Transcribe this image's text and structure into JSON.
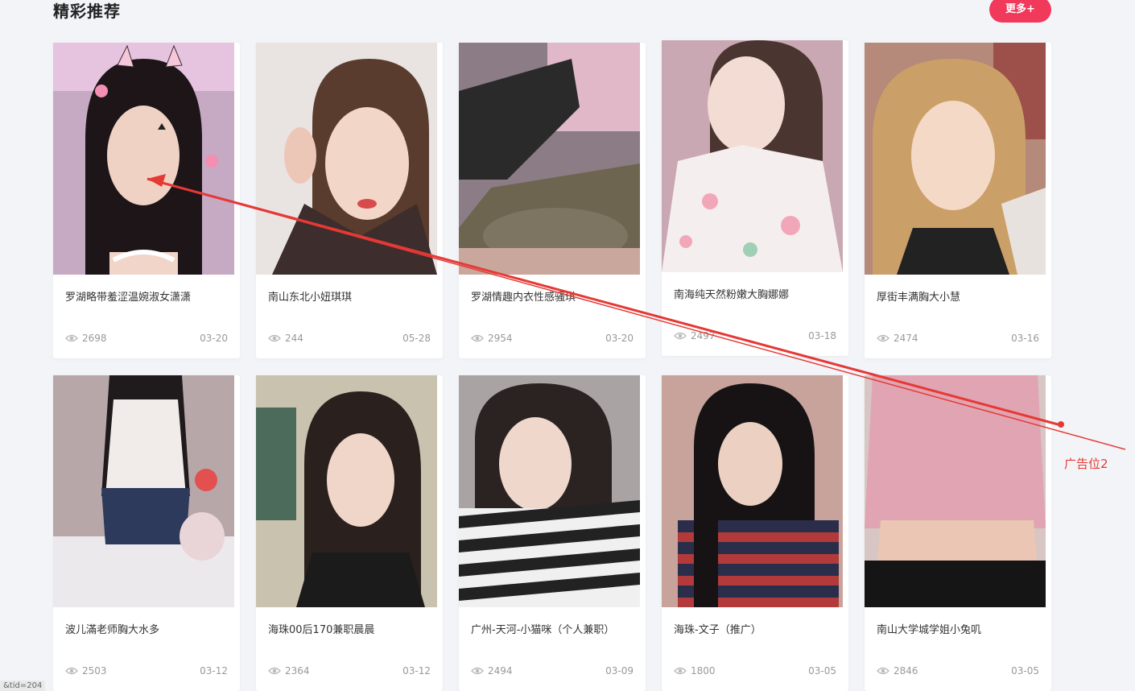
{
  "section": {
    "title": "精彩推荐",
    "more_label": "更多+"
  },
  "cards": [
    {
      "title": "罗湖略带羞涩温婉淑女潇潇",
      "views": "2698",
      "date": "03-20",
      "photo": "photo-woman-cat-ears"
    },
    {
      "title": "南山东北小妞琪琪",
      "views": "244",
      "date": "05-28",
      "photo": "photo-woman-selfie"
    },
    {
      "title": "罗湖情趣内衣性感骚琪",
      "views": "2954",
      "date": "03-20",
      "photo": "photo-fishnet-legs"
    },
    {
      "title": "南海纯天然粉嫩大胸娜娜",
      "views": "2497",
      "date": "03-18",
      "photo": "photo-woman-floral-shirt"
    },
    {
      "title": "厚街丰满胸大小慧",
      "views": "2474",
      "date": "03-16",
      "photo": "photo-woman-curly-hair"
    },
    {
      "title": "波儿滿老师胸大水多",
      "views": "2503",
      "date": "03-12",
      "photo": "photo-woman-white-top"
    },
    {
      "title": "海珠00后170兼职晨晨",
      "views": "2364",
      "date": "03-12",
      "photo": "photo-woman-long-hair"
    },
    {
      "title": "广州-天河-小猫咪（个人兼职）",
      "views": "2494",
      "date": "03-09",
      "photo": "photo-woman-striped-shirt"
    },
    {
      "title": "海珠-文子（推广）",
      "views": "1800",
      "date": "03-05",
      "photo": "photo-woman-red-stripes"
    },
    {
      "title": "南山大学城学姐小兔叽",
      "views": "2846",
      "date": "03-05",
      "photo": "photo-pink-crop-top"
    }
  ],
  "annotation": {
    "label": "广告位2",
    "color": "#e53935"
  },
  "status_url": "&tid=204",
  "colors": {
    "accent": "#f0395b",
    "background": "#f3f4f8"
  },
  "icons": {
    "views": "eye-icon"
  }
}
